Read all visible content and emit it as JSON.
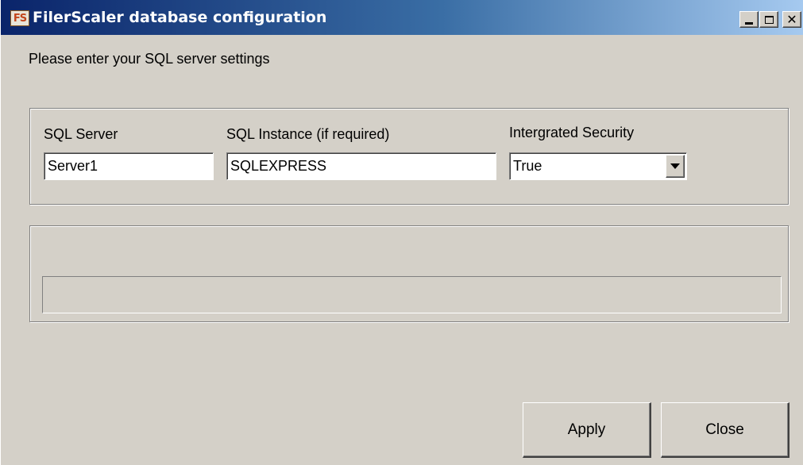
{
  "window": {
    "title": "FilerScaler database configuration",
    "icon_text": "FS",
    "title_buttons": {
      "minimize": "minimize-icon",
      "maximize": "maximize-icon",
      "close": "close-icon"
    }
  },
  "prompt": "Please enter your SQL server settings",
  "settings": {
    "sql_server": {
      "label": "SQL Server",
      "value": "Server1"
    },
    "sql_instance": {
      "label": "SQL Instance (if required)",
      "value": "SQLEXPRESS"
    },
    "integrated_security": {
      "label": "Intergrated Security",
      "selected": "True"
    }
  },
  "progress": {
    "fraction": 0
  },
  "buttons": {
    "apply": "Apply",
    "close": "Close"
  },
  "colors": {
    "title_gradient_start": "#0a246a",
    "title_gradient_end": "#a6caf0",
    "window_face": "#d4d0c8"
  }
}
